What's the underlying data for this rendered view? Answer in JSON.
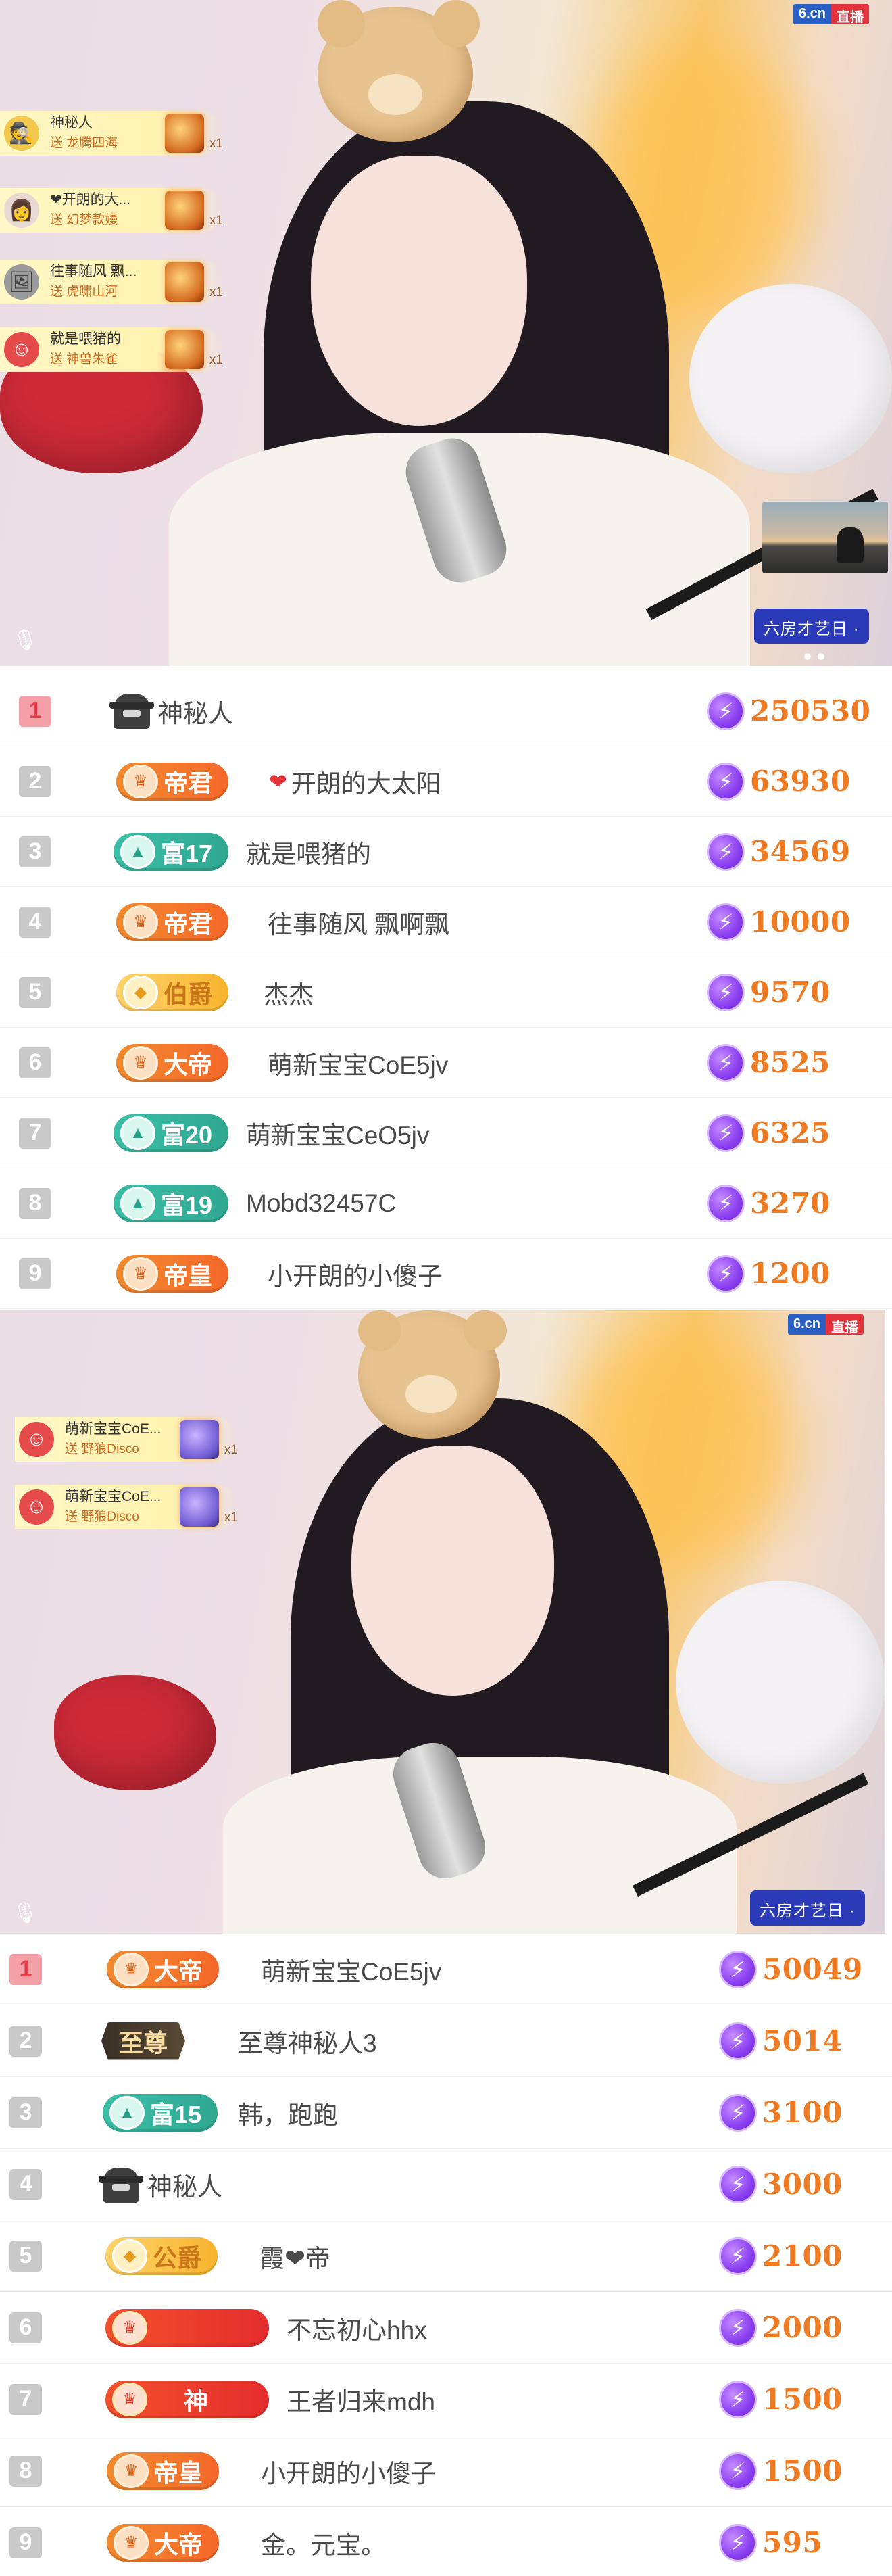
{
  "video1": {
    "site_badge": {
      "brand": "6.cn",
      "live": "直播"
    },
    "gift_notices": [
      {
        "user": "神秘人",
        "gift": "送 龙腾四海",
        "count": "x1",
        "avatar_icon": "mystery-man"
      },
      {
        "user": "❤开朗的大...",
        "gift": "送 幻梦款嫚",
        "count": "x1",
        "avatar_icon": "user-photo"
      },
      {
        "user": "往事随风 飘...",
        "gift": "送 虎啸山河",
        "count": "x1",
        "avatar_icon": "user-photo"
      },
      {
        "user": "就是喂猪的",
        "gift": "送 神兽朱雀",
        "count": "x1",
        "avatar_icon": "default-avatar"
      }
    ],
    "room_tag": "六房才艺日 ·"
  },
  "ranking1": [
    {
      "rank": "1",
      "badge": null,
      "mystery": true,
      "name": "神秘人",
      "score": "250530"
    },
    {
      "rank": "2",
      "badge": {
        "label": "帝君",
        "style": "orange"
      },
      "heart": true,
      "name": "开朗的大太阳",
      "score": "63930"
    },
    {
      "rank": "3",
      "badge": {
        "label": "富17",
        "style": "teal"
      },
      "name": "就是喂猪的",
      "score": "34569"
    },
    {
      "rank": "4",
      "badge": {
        "label": "帝君",
        "style": "orange"
      },
      "name": "往事随风 飘啊飘",
      "score": "10000"
    },
    {
      "rank": "5",
      "badge": {
        "label": "伯爵",
        "style": "gold"
      },
      "name": "杰杰",
      "score": "9570"
    },
    {
      "rank": "6",
      "badge": {
        "label": "大帝",
        "style": "orange"
      },
      "name": "萌新宝宝CoE5jv",
      "score": "8525"
    },
    {
      "rank": "7",
      "badge": {
        "label": "富20",
        "style": "teal"
      },
      "name": "萌新宝宝CeO5jv",
      "score": "6325"
    },
    {
      "rank": "8",
      "badge": {
        "label": "富19",
        "style": "teal"
      },
      "name": "Mobd32457C",
      "score": "3270"
    },
    {
      "rank": "9",
      "badge": {
        "label": "帝皇",
        "style": "orange"
      },
      "name": "小开朗的小傻子",
      "score": "1200"
    }
  ],
  "video2": {
    "site_badge": {
      "brand": "6.cn",
      "live": "直播"
    },
    "gift_notices": [
      {
        "user": "萌新宝宝CoE...",
        "gift": "送 野狼Disco",
        "count": "x1",
        "avatar_icon": "default-avatar"
      },
      {
        "user": "萌新宝宝CoE...",
        "gift": "送 野狼Disco",
        "count": "x1",
        "avatar_icon": "default-avatar"
      }
    ],
    "room_tag": "六房才艺日 ·"
  },
  "ranking2": [
    {
      "rank": "1",
      "badge": {
        "label": "大帝",
        "style": "orange"
      },
      "name": "萌新宝宝CoE5jv",
      "score": "50049"
    },
    {
      "rank": "2",
      "badge": {
        "label": "至尊",
        "style": "dark"
      },
      "name": "至尊神秘人3",
      "score": "5014"
    },
    {
      "rank": "3",
      "badge": {
        "label": "富15",
        "style": "teal"
      },
      "name": "韩，跑跑",
      "score": "3100"
    },
    {
      "rank": "4",
      "badge": null,
      "mystery": true,
      "name": "神秘人",
      "score": "3000"
    },
    {
      "rank": "5",
      "badge": {
        "label": "公爵",
        "style": "gold"
      },
      "name": "霞❤帝",
      "score": "2100"
    },
    {
      "rank": "6",
      "badge": {
        "label": "",
        "style": "red"
      },
      "name": "不忘初心hhx",
      "score": "2000"
    },
    {
      "rank": "7",
      "badge": {
        "label": "神",
        "style": "red"
      },
      "name": "王者归来mdh",
      "score": "1500"
    },
    {
      "rank": "8",
      "badge": {
        "label": "帝皇",
        "style": "orange"
      },
      "name": "小开朗的小傻子",
      "score": "1500"
    },
    {
      "rank": "9",
      "badge": {
        "label": "大帝",
        "style": "orange"
      },
      "name": "金。元宝。",
      "score": "595"
    }
  ]
}
